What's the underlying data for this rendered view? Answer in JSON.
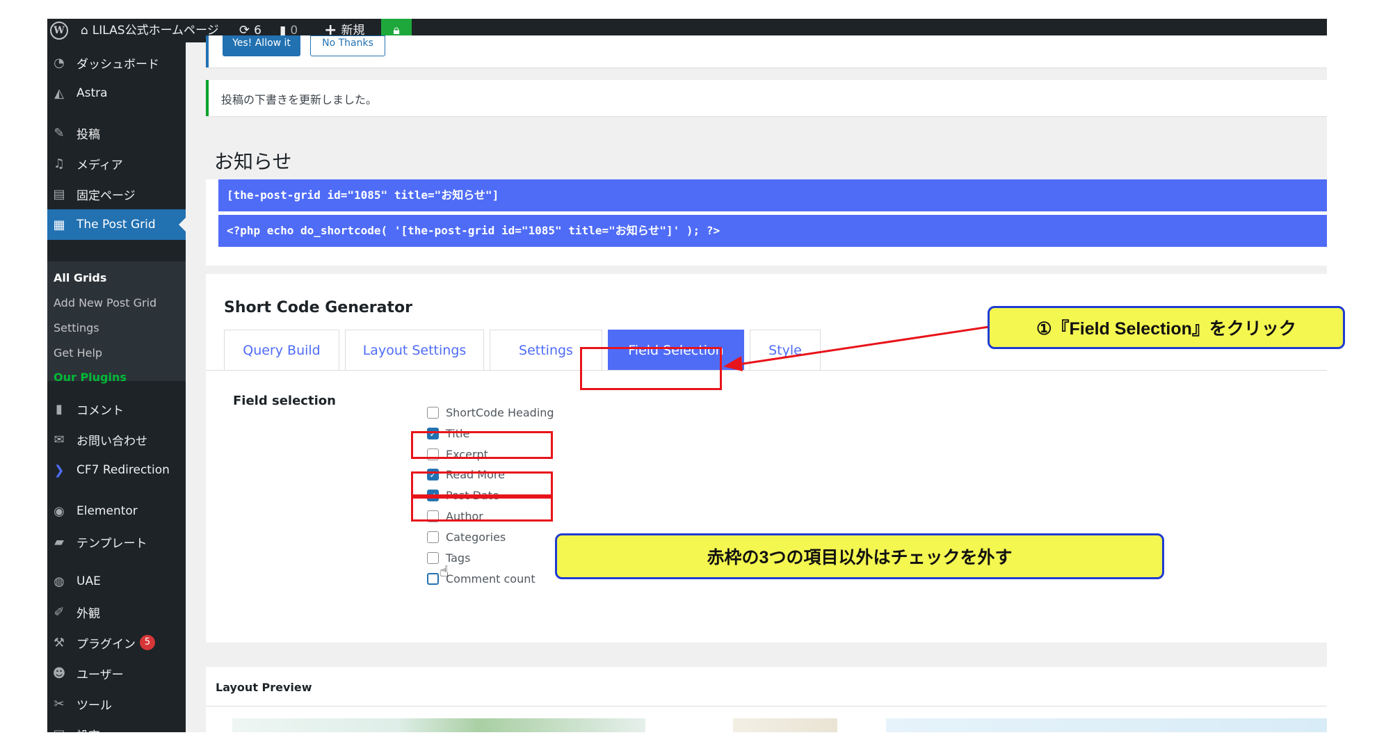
{
  "admin_bar": {
    "site_name": "LILAS公式ホームページ",
    "updates_count": "6",
    "comments_count": "0",
    "new_label": "新規",
    "lock_icon": "lock-icon"
  },
  "sidebar": {
    "items": [
      {
        "label": "ダッシュボード",
        "icon": "dashboard-icon"
      },
      {
        "label": "Astra",
        "icon": "astra-icon"
      },
      {
        "label": "投稿",
        "icon": "pin-icon"
      },
      {
        "label": "メディア",
        "icon": "media-icon"
      },
      {
        "label": "固定ページ",
        "icon": "page-icon"
      },
      {
        "label": "The Post Grid",
        "icon": "grid-icon"
      },
      {
        "label": "コメント",
        "icon": "comment-icon"
      },
      {
        "label": "お問い合わせ",
        "icon": "mail-icon"
      },
      {
        "label": "CF7 Redirection",
        "icon": "redirect-icon"
      },
      {
        "label": "Elementor",
        "icon": "elementor-icon"
      },
      {
        "label": "テンプレート",
        "icon": "folder-icon"
      },
      {
        "label": "UAE",
        "icon": "uae-icon"
      },
      {
        "label": "外観",
        "icon": "brush-icon"
      },
      {
        "label": "プラグイン",
        "icon": "plugin-icon",
        "badge": "5"
      },
      {
        "label": "ユーザー",
        "icon": "user-icon"
      },
      {
        "label": "ツール",
        "icon": "wrench-icon"
      },
      {
        "label": "設定",
        "icon": "settings-icon"
      }
    ],
    "submenu": [
      "All Grids",
      "Add New Post Grid",
      "Settings",
      "Get Help",
      "Our Plugins"
    ]
  },
  "notice_top": {
    "allow": "Yes! Allow it",
    "no": "No Thanks"
  },
  "notice": {
    "text": "投稿の下書きを更新しました。"
  },
  "page_title": "お知らせ",
  "shortcodes": [
    "[the-post-grid id=\"1085\" title=\"お知らせ\"]",
    "<?php echo do_shortcode( '[the-post-grid id=\"1085\" title=\"お知らせ\"]' ); ?>"
  ],
  "generator": {
    "title": "Short Code Generator",
    "tabs": [
      "Query Build",
      "Layout Settings",
      "Settings",
      "Field Selection",
      "Style"
    ],
    "active_tab": "Field Selection",
    "field_label": "Field selection",
    "fields": [
      {
        "label": "ShortCode Heading",
        "checked": false
      },
      {
        "label": "Title",
        "checked": true
      },
      {
        "label": "Excerpt",
        "checked": false
      },
      {
        "label": "Read More",
        "checked": true
      },
      {
        "label": "Post Date",
        "checked": true
      },
      {
        "label": "Author",
        "checked": false
      },
      {
        "label": "Categories",
        "checked": false
      },
      {
        "label": "Tags",
        "checked": false
      },
      {
        "label": "Comment count",
        "checked": false
      }
    ]
  },
  "layout_preview": {
    "title": "Layout Preview"
  },
  "annotations": {
    "callout1": "①『Field Selection』をクリック",
    "callout2": "赤枠の3つの項目以外はチェックを外す",
    "highlight_color": "#e8141b",
    "callout_fill": "#f4f750",
    "callout_border": "#1f3bd3"
  },
  "colors": {
    "accent": "#4f6cf7",
    "wp_blue": "#2271b1",
    "sidebar": "#1d2327"
  }
}
